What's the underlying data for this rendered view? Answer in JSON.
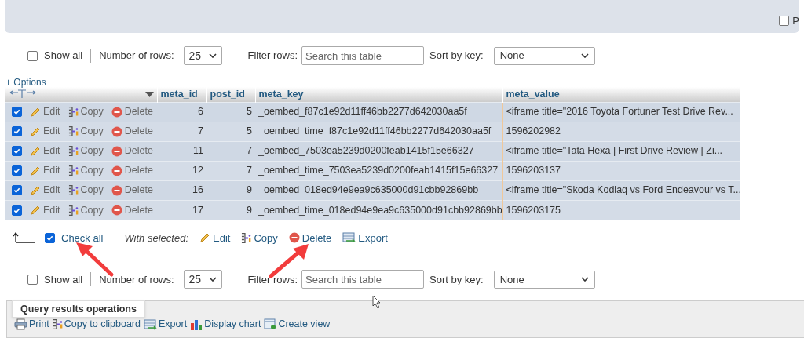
{
  "query_panel": {
    "checkbox": {
      "label": "P",
      "checked": false
    }
  },
  "navigation": [
    {
      "show_all": {
        "label": "Show all",
        "checked": false
      },
      "rows_label": "Number of rows:",
      "rows_value": "25",
      "filter_label": "Filter rows:",
      "filter_placeholder": "Search this table",
      "sort_label": "Sort by key:",
      "sort_value": "None"
    },
    {
      "show_all": {
        "label": "Show all",
        "checked": false
      },
      "rows_label": "Number of rows:",
      "rows_value": "25",
      "filter_label": "Filter rows:",
      "filter_placeholder": "Search this table",
      "sort_label": "Sort by key:",
      "sort_value": "None"
    }
  ],
  "options_link": "+ Options",
  "table": {
    "columns": [
      "meta_id",
      "post_id",
      "meta_key",
      "meta_value"
    ],
    "rows": [
      {
        "checked": true,
        "actions": [
          {
            "kind": "edit",
            "label": "Edit"
          },
          {
            "kind": "copy",
            "label": "Copy"
          },
          {
            "kind": "delete",
            "label": "Delete"
          }
        ],
        "cells": [
          "6",
          "5",
          "_oembed_f87c1e92d11ff46bb2277d642030aa5f",
          "<iframe title=\"2016 Toyota Fortuner Test Drive Rev..."
        ]
      },
      {
        "checked": true,
        "actions": [
          {
            "kind": "edit",
            "label": "Edit"
          },
          {
            "kind": "copy",
            "label": "Copy"
          },
          {
            "kind": "delete",
            "label": "Delete"
          }
        ],
        "cells": [
          "7",
          "5",
          "_oembed_time_f87c1e92d11ff46bb2277d642030aa5f",
          "1596202982"
        ]
      },
      {
        "checked": true,
        "actions": [
          {
            "kind": "edit",
            "label": "Edit"
          },
          {
            "kind": "copy",
            "label": "Copy"
          },
          {
            "kind": "delete",
            "label": "Delete"
          }
        ],
        "cells": [
          "11",
          "7",
          "_oembed_7503ea5239d0200feab1415f15e66327",
          "<iframe title=\"Tata Hexa | First Drive Review | Zi..."
        ]
      },
      {
        "checked": true,
        "actions": [
          {
            "kind": "edit",
            "label": "Edit"
          },
          {
            "kind": "copy",
            "label": "Copy"
          },
          {
            "kind": "delete",
            "label": "Delete"
          }
        ],
        "cells": [
          "12",
          "7",
          "_oembed_time_7503ea5239d0200feab1415f15e66327",
          "1596203137"
        ]
      },
      {
        "checked": true,
        "actions": [
          {
            "kind": "edit",
            "label": "Edit"
          },
          {
            "kind": "copy",
            "label": "Copy"
          },
          {
            "kind": "delete",
            "label": "Delete"
          }
        ],
        "cells": [
          "16",
          "9",
          "_oembed_018ed94e9ea9c635000d91cbb92869bb",
          "<iframe title=\"Skoda Kodiaq vs Ford Endeavour vs T..."
        ]
      },
      {
        "checked": true,
        "actions": [
          {
            "kind": "edit",
            "label": "Edit"
          },
          {
            "kind": "copy",
            "label": "Copy"
          },
          {
            "kind": "delete",
            "label": "Delete"
          }
        ],
        "cells": [
          "17",
          "9",
          "_oembed_time_018ed94e9ea9c635000d91cbb92869bb",
          "1596203175"
        ]
      }
    ]
  },
  "with_selected": {
    "check_all": {
      "label": "Check all",
      "checked": true
    },
    "label": "With selected:",
    "actions": [
      {
        "kind": "edit",
        "label": "Edit"
      },
      {
        "kind": "copy",
        "label": "Copy"
      },
      {
        "kind": "delete",
        "label": "Delete"
      },
      {
        "kind": "export",
        "label": "Export"
      }
    ]
  },
  "operations": {
    "legend": "Query results operations",
    "actions": [
      {
        "kind": "print",
        "label": "Print"
      },
      {
        "kind": "copy",
        "label": "Copy to clipboard"
      },
      {
        "kind": "export",
        "label": "Export"
      },
      {
        "kind": "chart",
        "label": "Display chart"
      },
      {
        "kind": "view",
        "label": "Create view"
      }
    ]
  }
}
